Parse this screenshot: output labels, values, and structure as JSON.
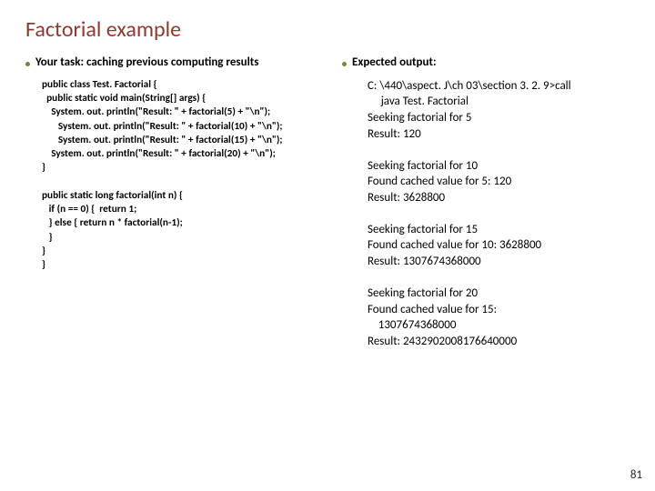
{
  "title": "Factorial example",
  "left": {
    "bullet": "Your task: caching previous computing results",
    "code": "public class Test. Factorial {\n  public static void main(String[] args) {\n    System. out. println(\"Result: \" + factorial(5) + \"\\n\");\n       System. out. println(\"Result: \" + factorial(10) + \"\\n\");\n       System. out. println(\"Result: \" + factorial(15) + \"\\n\");\n    System. out. println(\"Result: \" + factorial(20) + \"\\n\");\n}\n\npublic static long factorial(int n) {\n   if (n == 0) {  return 1;\n   } else { return n * factorial(n-1);\n   }\n}\n}"
  },
  "right": {
    "bullet": "Expected output:",
    "output": "C: \\440\\aspect. J\\ch 03\\section 3. 2. 9>call\n     java Test. Factorial\nSeeking factorial for 5\nResult: 120\n\nSeeking factorial for 10\nFound cached value for 5: 120\nResult: 3628800\n\nSeeking factorial for 15\nFound cached value for 10: 3628800\nResult: 1307674368000\n\nSeeking factorial for 20\nFound cached value for 15:\n    1307674368000\nResult: 2432902008176640000"
  },
  "page_number": "81"
}
